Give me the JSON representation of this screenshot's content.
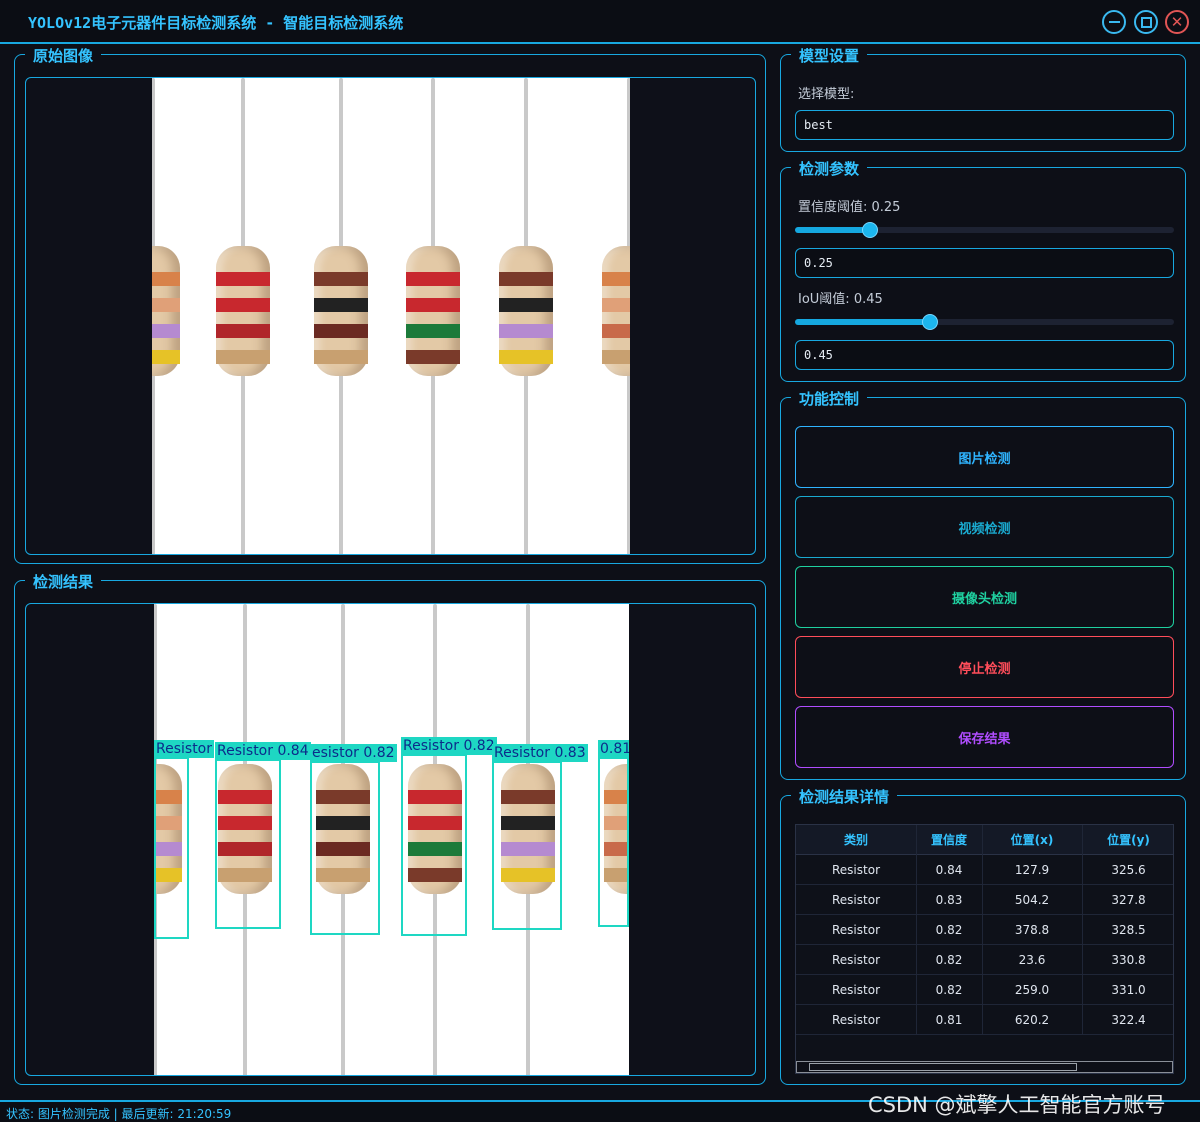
{
  "window": {
    "title": "YOLOv12电子元器件目标检测系统 - 智能目标检测系统",
    "min_icon": "minimize-icon",
    "max_icon": "maximize-icon",
    "close_icon": "close-icon"
  },
  "original_panel": {
    "title": "原始图像"
  },
  "result_panel": {
    "title": "检测结果"
  },
  "model_settings": {
    "title": "模型设置",
    "select_label": "选择模型:",
    "model_value": "best"
  },
  "detect_params": {
    "title": "检测参数",
    "conf_label": "置信度阈值: 0.25",
    "conf_value": 0.25,
    "conf_text": "0.25",
    "iou_label": "IoU阈值: 0.45",
    "iou_value": 0.45,
    "iou_text": "0.45"
  },
  "functions": {
    "title": "功能控制",
    "buttons": [
      {
        "label": "图片检测",
        "color": "#2fb4ff"
      },
      {
        "label": "视频检测",
        "color": "#1aaad0"
      },
      {
        "label": "摄像头检测",
        "color": "#1fd0a0"
      },
      {
        "label": "停止检测",
        "color": "#ff4d5a"
      },
      {
        "label": "保存结果",
        "color": "#b04dff"
      }
    ]
  },
  "results": {
    "title": "检测结果详情",
    "columns": [
      "类别",
      "置信度",
      "位置(x)",
      "位置(y)"
    ],
    "rows": [
      [
        "Resistor",
        "0.84",
        "127.9",
        "325.6"
      ],
      [
        "Resistor",
        "0.83",
        "504.2",
        "327.8"
      ],
      [
        "Resistor",
        "0.82",
        "378.8",
        "328.5"
      ],
      [
        "Resistor",
        "0.82",
        "23.6",
        "330.8"
      ],
      [
        "Resistor",
        "0.82",
        "259.0",
        "331.0"
      ],
      [
        "Resistor",
        "0.81",
        "620.2",
        "322.4"
      ]
    ]
  },
  "detections": [
    {
      "label": "Resistor",
      "conf": ""
    },
    {
      "label": "Resistor",
      "conf": "0.84"
    },
    {
      "label": "esistor",
      "conf": "0.82"
    },
    {
      "label": "Resistor",
      "conf": "0.82"
    },
    {
      "label": "Resistor",
      "conf": "0.83"
    },
    {
      "label": "",
      "conf": "0.81"
    }
  ],
  "status": "状态: 图片检测完成 | 最后更新: 21:20:59",
  "watermark": "CSDN @斌擎人工智能官方账号"
}
